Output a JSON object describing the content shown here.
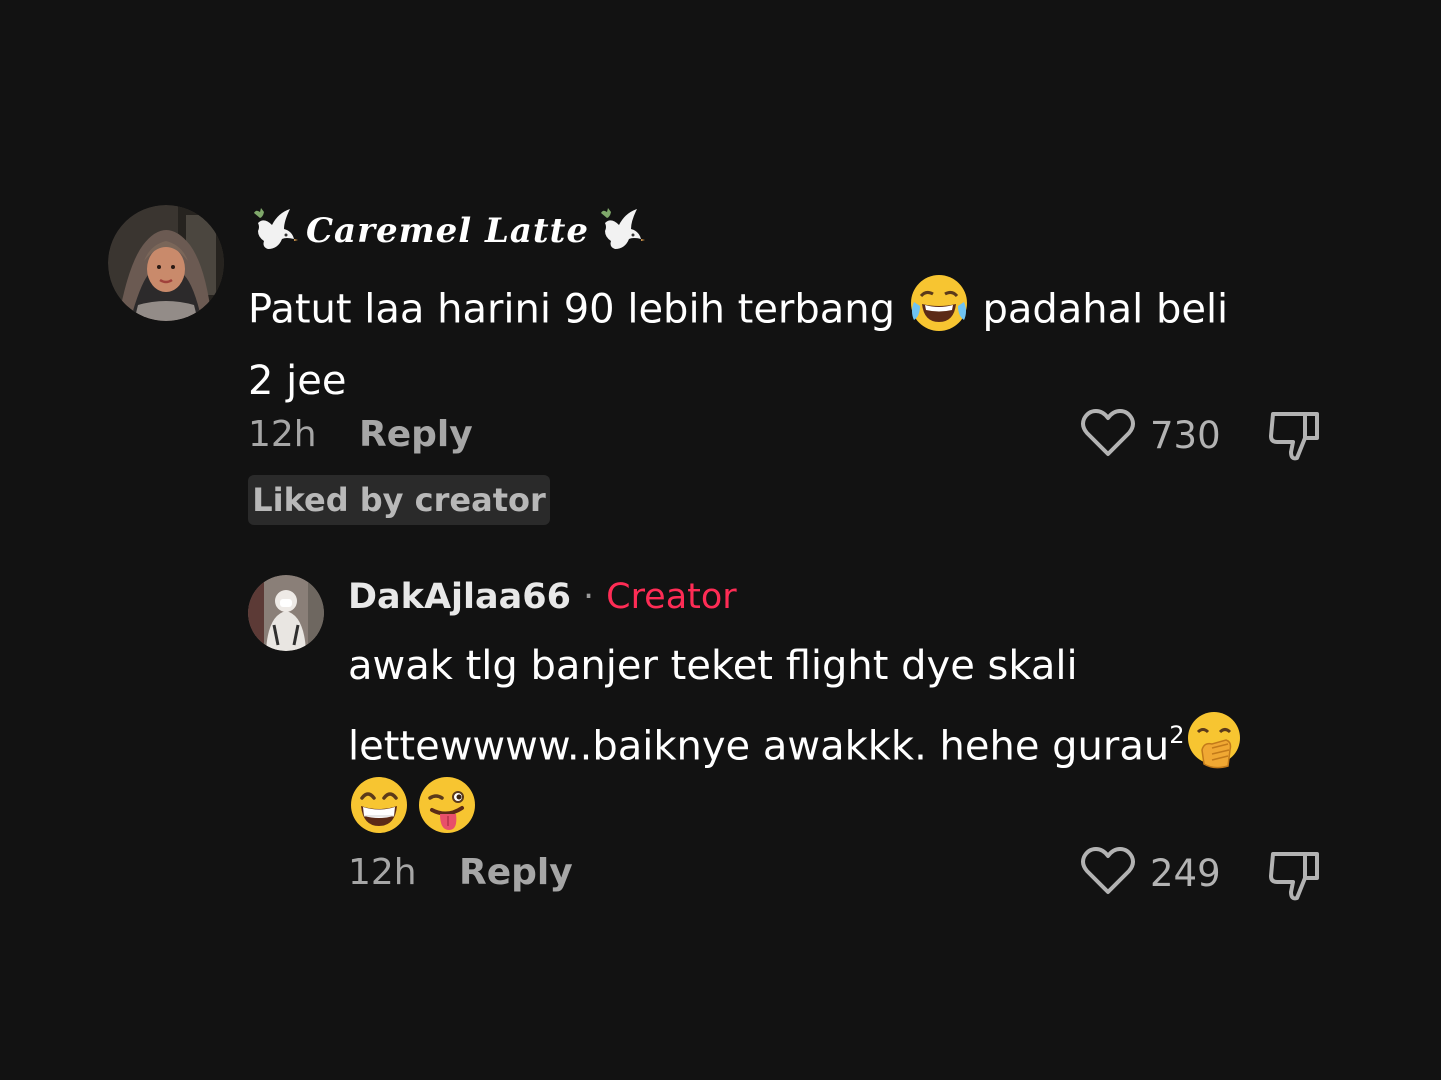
{
  "comments": [
    {
      "username": "Caremel Latte",
      "text_before_emoji": "Patut laa harini 90 lebih terbang ",
      "text_after_emoji": " padahal beli",
      "text_line2": "2 jee",
      "emoji": "face-with-tears-of-joy",
      "time": "12h",
      "reply_label": "Reply",
      "likes": "730",
      "badge": "Liked by creator"
    },
    {
      "username": "DakAjlaa66",
      "separator": "·",
      "role": "Creator",
      "text_line1": "awak tlg banjer teket flight dye skali",
      "text_line2": "lettewwww..baiknye awakkk. hehe gurau",
      "superscript": "2",
      "emojis": [
        "face-with-hand-over-mouth",
        "grinning-face-with-smiling-eyes",
        "winking-face-with-tongue"
      ],
      "time": "12h",
      "reply_label": "Reply",
      "likes": "249"
    }
  ],
  "colors": {
    "background": "#121212",
    "creator_tag": "#fe2c55",
    "secondary_text": "#a6a6a6",
    "badge_bg": "#2a2a2a"
  }
}
